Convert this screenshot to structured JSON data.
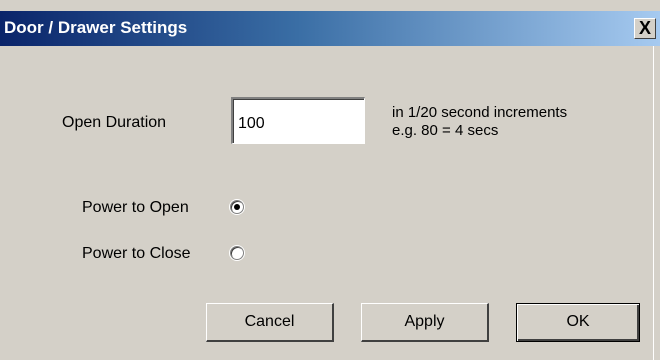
{
  "window": {
    "title": "Door / Drawer Settings",
    "close_glyph": "X"
  },
  "open_duration": {
    "label": "Open Duration",
    "value": "100",
    "hint_line1": "in 1/20 second increments",
    "hint_line2": "e.g. 80 = 4 secs"
  },
  "power_mode": {
    "options": [
      {
        "label": "Power to Open",
        "selected": true
      },
      {
        "label": "Power to Close",
        "selected": false
      }
    ]
  },
  "buttons": {
    "cancel_label": "Cancel",
    "apply_label": "Apply",
    "ok_label": "OK"
  },
  "icons": {
    "close": "close-icon",
    "radio": "radio-icon"
  }
}
